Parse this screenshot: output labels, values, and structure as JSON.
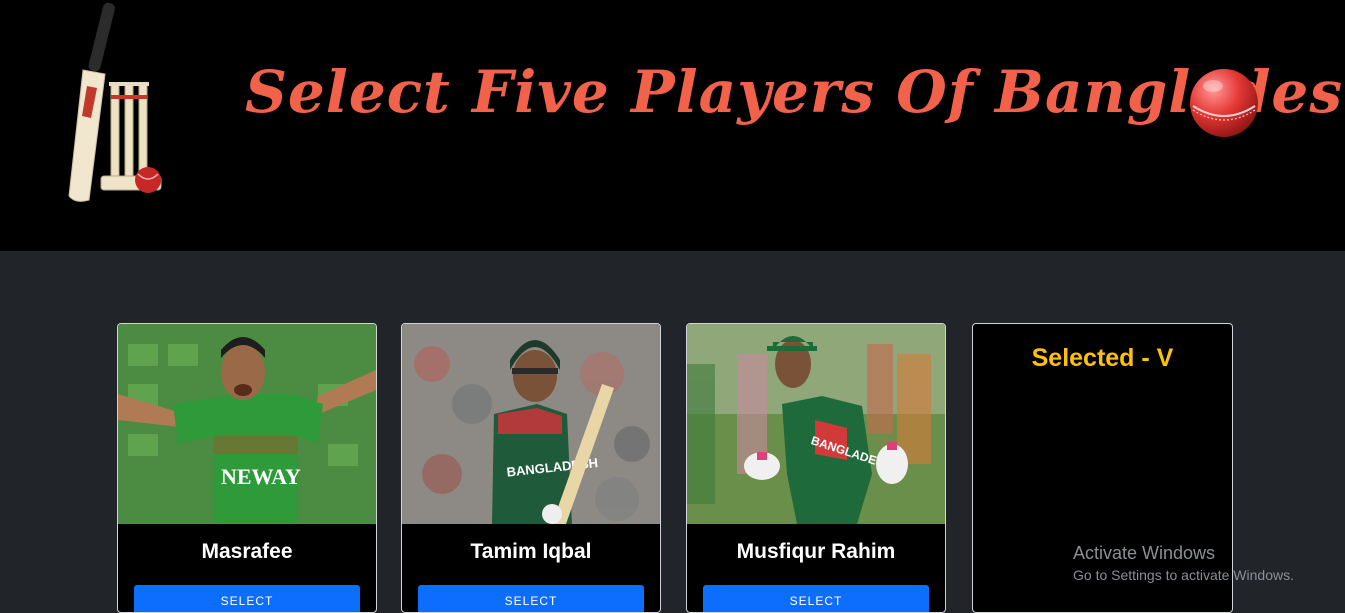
{
  "header": {
    "title": "Select Five Players Of Bangladesh",
    "logo_icon": "cricket-bat-stumps-icon",
    "ball_icon": "cricket-ball-icon"
  },
  "players": [
    {
      "name": "Masrafee",
      "button_label": "SELECT",
      "jersey_text": "NEWAY"
    },
    {
      "name": "Tamim Iqbal",
      "button_label": "SELECT",
      "jersey_text": "BANGLADESH"
    },
    {
      "name": "Musfiqur Rahim",
      "button_label": "SELECT",
      "jersey_text": "BANGLADESH"
    }
  ],
  "selected_panel": {
    "title": "Selected - V"
  },
  "watermark": {
    "title": "Activate Windows",
    "subtitle": "Go to Settings to activate Windows."
  },
  "colors": {
    "header_bg": "#000000",
    "page_bg": "#212529",
    "title": "#f2624a",
    "button": "#0d6efd",
    "selected_title": "#ffc107"
  }
}
